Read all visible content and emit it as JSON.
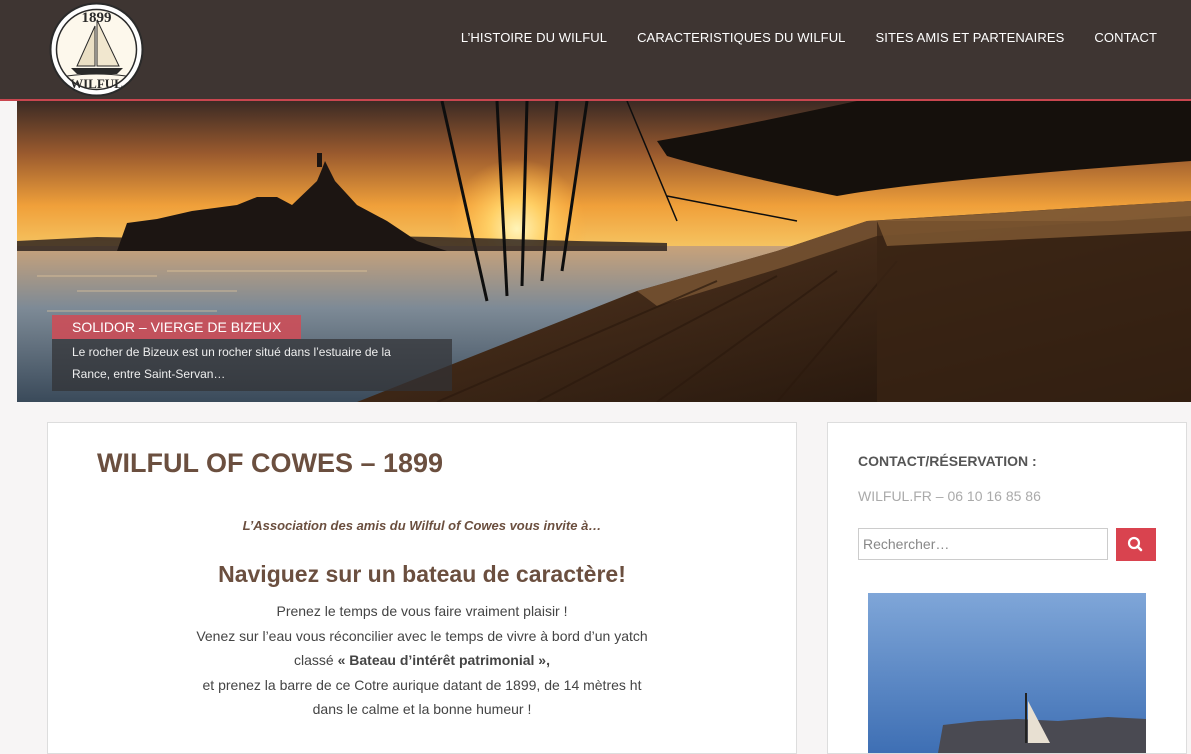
{
  "site": {
    "logo": {
      "year": "1899",
      "name": "WILFUL",
      "icon": "sailboat-logo-icon"
    }
  },
  "nav": {
    "items": [
      {
        "label": "L’HISTOIRE DU WILFUL"
      },
      {
        "label": "CARACTERISTIQUES DU WILFUL"
      },
      {
        "label": "SITES AMIS ET PARTENAIRES"
      },
      {
        "label": "CONTACT"
      }
    ]
  },
  "hero": {
    "caption_title": "SOLIDOR – VIERGE DE BIZEUX",
    "caption_text": "Le rocher de Bizeux est un rocher situé dans l’estuaire de la Rance, entre Saint-Servan…"
  },
  "main": {
    "title": "WILFUL OF COWES – 1899",
    "intro": "L’Association des amis du Wilful of Cowes vous invite à…",
    "headline": "Naviguez sur un bateau de caractère!",
    "lines": [
      "Prenez le temps de vous faire vraiment plaisir !",
      "Venez sur l’eau vous réconcilier avec le temps de vivre à bord d’un yatch",
      "classé",
      "« Bateau d’intérêt patrimonial »,",
      "et prenez la barre de ce Cotre aurique datant de 1899, de 14 mètres ht",
      "dans le calme et la bonne humeur !"
    ]
  },
  "sidebar": {
    "contact_title": "CONTACT/RÉSERVATION :",
    "contact_info": "WILFUL.FR – 06 10 16 85 86",
    "search_placeholder": "Rechercher…",
    "search_icon": "search-icon"
  },
  "colors": {
    "header_bg": "#3e3532",
    "accent": "#d9434f",
    "title_brown": "#6b4f3f"
  }
}
